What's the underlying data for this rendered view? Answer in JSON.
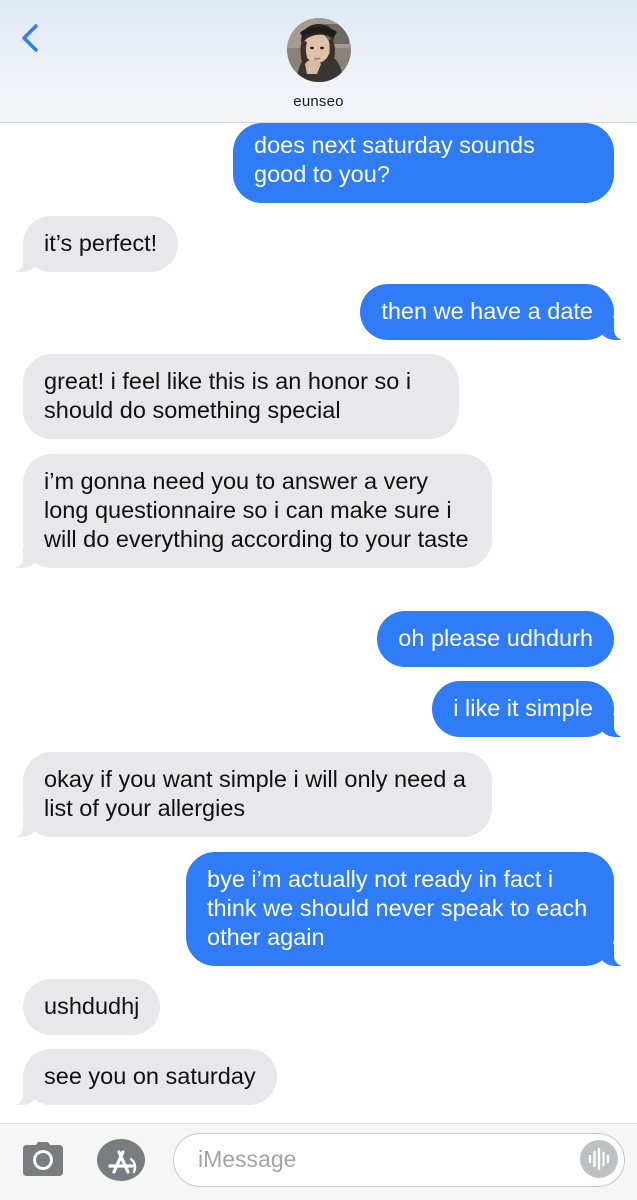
{
  "header": {
    "contact_name": "eunseo",
    "back_icon": "chevron-left-icon",
    "avatar_icon": "contact-avatar"
  },
  "messages": [
    {
      "from": "me",
      "text": "does next saturday sounds good to you?"
    },
    {
      "from": "them",
      "text": "it’s perfect!"
    },
    {
      "from": "me",
      "text": "then we have a date"
    },
    {
      "from": "them",
      "text": "great! i feel like this is an honor so i should do something special"
    },
    {
      "from": "them",
      "text": "i’m gonna need you to answer a very long questionnaire so i can make sure i will do everything according to your taste"
    },
    {
      "from": "me",
      "text": "oh please udhdurh"
    },
    {
      "from": "me",
      "text": "i like it simple"
    },
    {
      "from": "them",
      "text": "okay if you want simple i will only need a list of your allergies"
    },
    {
      "from": "me",
      "text": "bye i’m actually not ready in fact i think we should never speak to each other again"
    },
    {
      "from": "them",
      "text": "ushdudhj"
    },
    {
      "from": "them",
      "text": "see you on saturday"
    }
  ],
  "input_bar": {
    "placeholder": "iMessage",
    "value": "",
    "camera_icon": "camera-icon",
    "apps_icon": "app-store-icon",
    "audio_icon": "audio-waveform-icon"
  },
  "colors": {
    "sent_bubble": "#2f7cf6",
    "received_bubble": "#e8e8ec",
    "accent": "#2f7cf6"
  }
}
